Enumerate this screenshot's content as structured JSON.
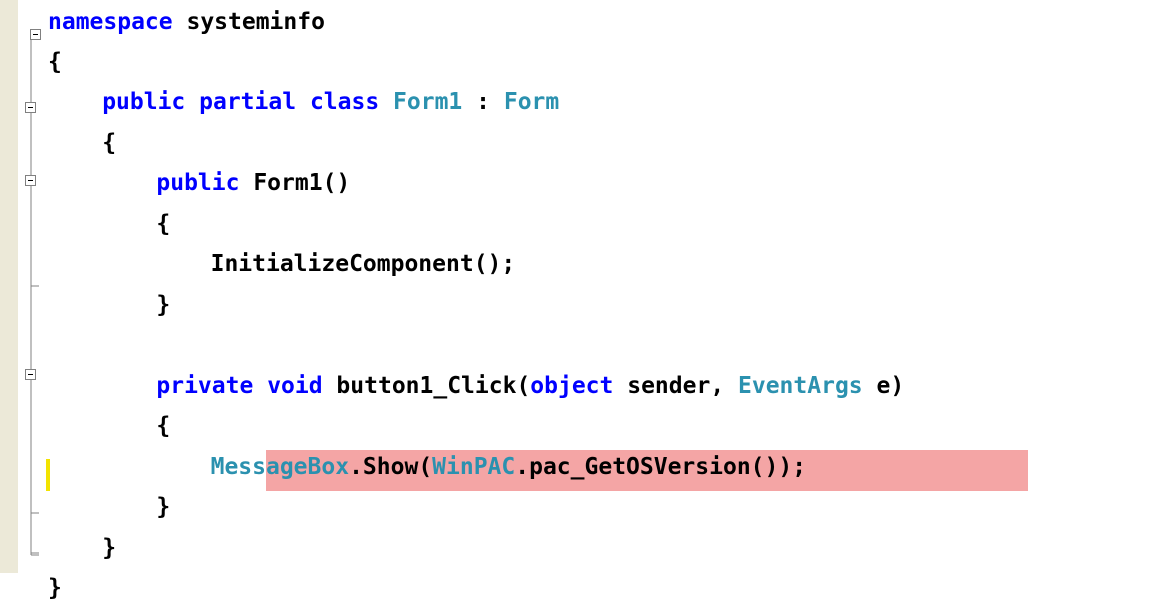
{
  "editor": {
    "highlight_color": "#f4a5a5",
    "keyword_color": "#0000ff",
    "type_color": "#2b91af",
    "changed_line_marker_color": "#f2e300",
    "lines": [
      {
        "indent": 0,
        "tokens": [
          {
            "t": "namespace",
            "k": "kw"
          },
          {
            "t": " systeminfo",
            "k": ""
          }
        ]
      },
      {
        "indent": 0,
        "tokens": [
          {
            "t": "{",
            "k": ""
          }
        ]
      },
      {
        "indent": 4,
        "tokens": [
          {
            "t": "public",
            "k": "kw"
          },
          {
            "t": " ",
            "k": ""
          },
          {
            "t": "partial",
            "k": "kw"
          },
          {
            "t": " ",
            "k": ""
          },
          {
            "t": "class",
            "k": "kw"
          },
          {
            "t": " ",
            "k": ""
          },
          {
            "t": "Form1",
            "k": "type"
          },
          {
            "t": " : ",
            "k": ""
          },
          {
            "t": "Form",
            "k": "type"
          }
        ]
      },
      {
        "indent": 4,
        "tokens": [
          {
            "t": "{",
            "k": ""
          }
        ]
      },
      {
        "indent": 8,
        "tokens": [
          {
            "t": "public",
            "k": "kw"
          },
          {
            "t": " Form1()",
            "k": ""
          }
        ]
      },
      {
        "indent": 8,
        "tokens": [
          {
            "t": "{",
            "k": ""
          }
        ]
      },
      {
        "indent": 12,
        "tokens": [
          {
            "t": "InitializeComponent();",
            "k": ""
          }
        ]
      },
      {
        "indent": 8,
        "tokens": [
          {
            "t": "}",
            "k": ""
          }
        ]
      },
      {
        "indent": 0,
        "tokens": []
      },
      {
        "indent": 8,
        "tokens": [
          {
            "t": "private",
            "k": "kw"
          },
          {
            "t": " ",
            "k": ""
          },
          {
            "t": "void",
            "k": "kw"
          },
          {
            "t": " button1_Click(",
            "k": ""
          },
          {
            "t": "object",
            "k": "kw"
          },
          {
            "t": " sender, ",
            "k": ""
          },
          {
            "t": "EventArgs",
            "k": "type"
          },
          {
            "t": " e)",
            "k": ""
          }
        ]
      },
      {
        "indent": 8,
        "tokens": [
          {
            "t": "{",
            "k": ""
          }
        ]
      },
      {
        "indent": 12,
        "tokens": [
          {
            "t": "MessageBox",
            "k": "type"
          },
          {
            "t": ".Show(",
            "k": ""
          },
          {
            "t": "WinPAC",
            "k": "type"
          },
          {
            "t": ".pac_GetOSVersion());",
            "k": ""
          }
        ]
      },
      {
        "indent": 8,
        "tokens": [
          {
            "t": "}",
            "k": ""
          }
        ]
      },
      {
        "indent": 4,
        "tokens": [
          {
            "t": "}",
            "k": ""
          }
        ]
      },
      {
        "indent": 0,
        "tokens": [
          {
            "t": "}",
            "k": ""
          }
        ]
      }
    ]
  }
}
